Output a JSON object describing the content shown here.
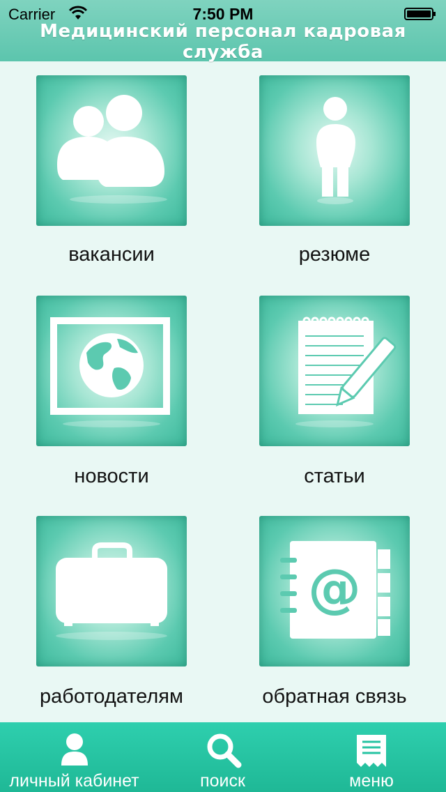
{
  "status_bar": {
    "carrier": "Carrier",
    "time": "7:50 PM"
  },
  "header": {
    "title": "Медицинский персонал кадровая служба"
  },
  "tiles": [
    {
      "label": "вакансии",
      "icon": "users-icon"
    },
    {
      "label": "резюме",
      "icon": "person-icon"
    },
    {
      "label": "новости",
      "icon": "globe-icon"
    },
    {
      "label": "статьи",
      "icon": "notepad-icon"
    },
    {
      "label": "работодателям",
      "icon": "briefcase-icon"
    },
    {
      "label": "обратная связь",
      "icon": "address-book-icon"
    }
  ],
  "tabbar": {
    "items": [
      {
        "label": "личный кабинет",
        "icon": "user-icon"
      },
      {
        "label": "поиск",
        "icon": "search-icon"
      },
      {
        "label": "меню",
        "icon": "menu-icon"
      }
    ]
  },
  "colors": {
    "header": "#6ccbb5",
    "tile": "#4cc3a7",
    "tabbar": "#25c3a2",
    "background": "#e9f8f4"
  }
}
